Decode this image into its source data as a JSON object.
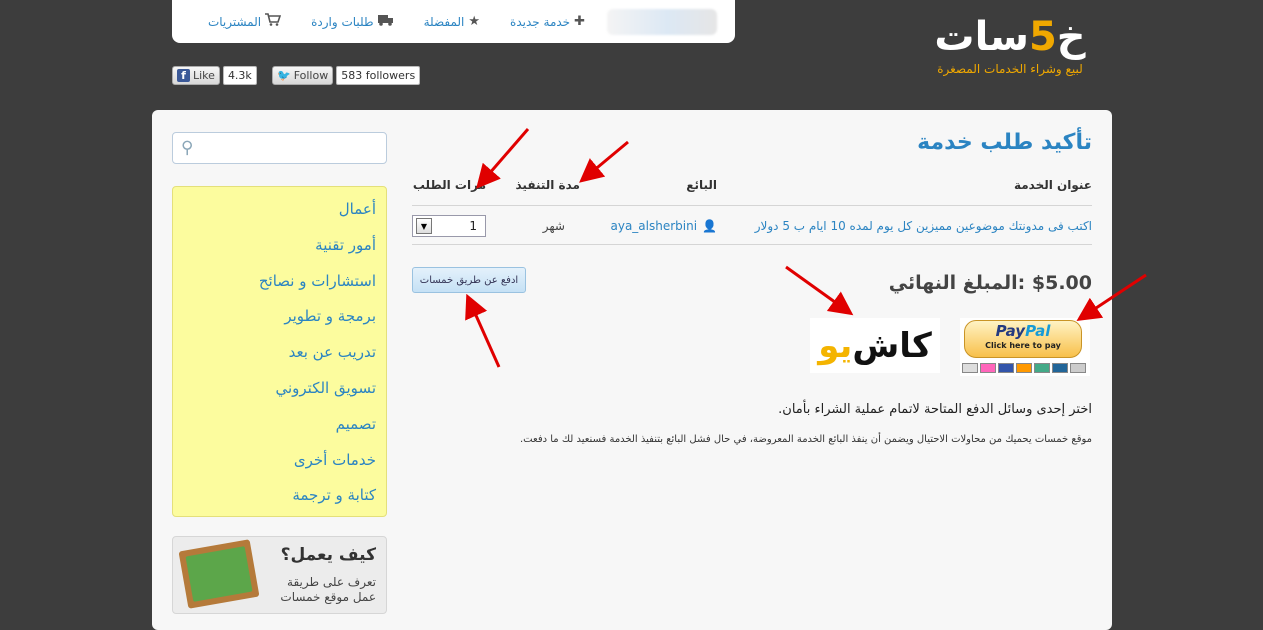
{
  "topnav": {
    "items": [
      {
        "label": "خدمة جديدة",
        "icon": "plus-icon"
      },
      {
        "label": "المفضلة",
        "icon": "star-icon"
      },
      {
        "label": "طلبات واردة",
        "icon": "truck-icon"
      },
      {
        "label": "المشتريات",
        "icon": "cart-icon"
      }
    ]
  },
  "logo": {
    "word_before": "خ",
    "five": "5",
    "word_after": "سات",
    "tagline": "لبيع وشراء الخدمات المصغرة"
  },
  "social": {
    "facebook": {
      "label": "Like",
      "count": "4.3k"
    },
    "twitter": {
      "label": "Follow",
      "count": "583 followers"
    }
  },
  "sidebar": {
    "search": {
      "placeholder": ""
    },
    "categories": [
      "أعمال",
      "أمور تقنية",
      "استشارات و نصائح",
      "برمجة و تطوير",
      "تدريب عن بعد",
      "تسويق الكتروني",
      "تصميم",
      "خدمات أخرى",
      "كتابة و ترجمة"
    ],
    "howto": {
      "title": "كيف يعمل؟",
      "desc": "تعرف على طريقة عمل موقع خمسات"
    }
  },
  "content": {
    "title": "تأكيد طلب خدمة",
    "table": {
      "headers": {
        "service": "عنوان الخدمة",
        "seller": "البائع",
        "duration": "مدة التنفيذ",
        "times": "مرات الطلب"
      },
      "row": {
        "service": "اكتب فى مدونتك موضوعين مميزين كل يوم لمده 10 ايام ب 5 دولار",
        "seller": "aya_alsherbini",
        "duration": "شهر",
        "times": "1"
      }
    },
    "pay_button": "ادفع عن طريق خمسات",
    "total": {
      "label": "المبلغ النهائي:",
      "value": "$5.00"
    },
    "paypal": {
      "brand_a": "Pay",
      "brand_b": "Pal",
      "sub": "Click here to pay"
    },
    "cashu": {
      "a": "كاش",
      "b": "يو"
    },
    "choose_text": "اختر إحدى وسائل الدفع المتاحة لاتمام عملية الشراء بأمان.",
    "info_text": "موقع خمسات يحميك من محاولات الاحتيال ويضمن أن ينفذ البائع الخدمة المعروضة، في حال فشل البائع بتنفيذ الخدمة فسنعيد لك ما دفعت."
  },
  "colors": {
    "link": "#2b84c2",
    "arrow": "#e00000",
    "background": "#3d3d3d",
    "logo_accent": "#f0a800"
  }
}
